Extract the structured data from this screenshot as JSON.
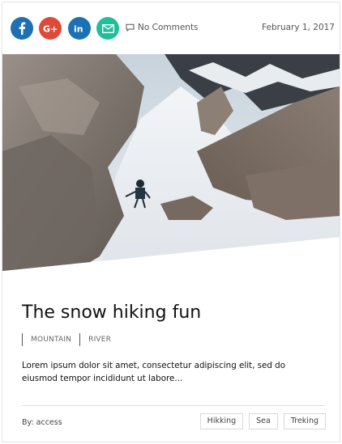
{
  "share": {
    "icons": [
      "facebook-icon",
      "google-plus-icon",
      "linkedin-icon",
      "email-icon"
    ],
    "colors": {
      "facebook": "#1f6fb3",
      "google_plus": "#df4a38",
      "linkedin": "#1a72b5",
      "email": "#1fbf9a"
    }
  },
  "meta": {
    "comments_label": "No Comments",
    "date": "February 1, 2017"
  },
  "post": {
    "title": "The snow hiking fun",
    "categories": [
      "MOUNTAIN",
      "RIVER"
    ],
    "excerpt": "Lorem ipsum dolor sit amet, consectetur adipiscing elit, sed do eiusmod tempor incididunt ut labore...",
    "author_label": "By: access",
    "tags": [
      "Hikking",
      "Sea",
      "Treking"
    ]
  }
}
